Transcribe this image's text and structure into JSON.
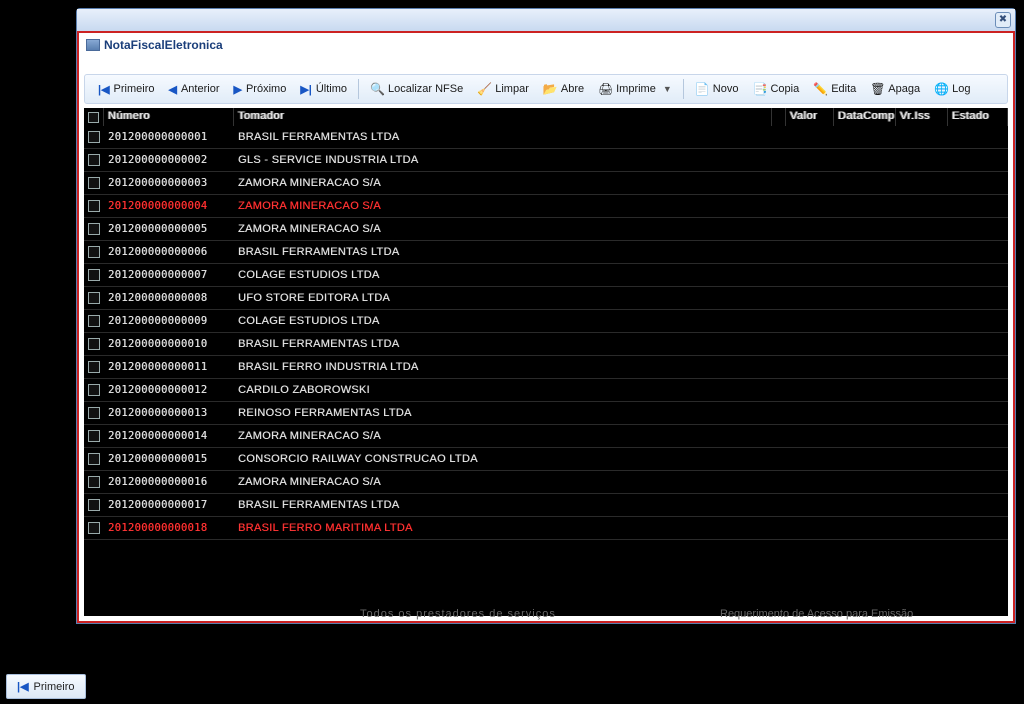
{
  "window": {
    "inner_title": "NotaFiscalEletronica"
  },
  "toolbar": {
    "primeiro": "Primeiro",
    "anterior": "Anterior",
    "proximo": "Próximo",
    "ultimo": "Último",
    "localizar": "Localizar NFSe",
    "limpar": "Limpar",
    "abre": "Abre",
    "imprime": "Imprime",
    "novo": "Novo",
    "copia": "Copia",
    "edita": "Edita",
    "apaga": "Apaga",
    "log": "Log"
  },
  "columns": {
    "numero": "Número",
    "tomador": "Tomador",
    "valor": "Valor",
    "dataComp": "DataComp",
    "vrIss": "Vr.Iss",
    "estado": "Estado"
  },
  "rows": [
    {
      "numero": "201200000000001",
      "tomador": "BRASIL FERRAMENTAS LTDA",
      "red": false
    },
    {
      "numero": "201200000000002",
      "tomador": "GLS - SERVICE INDUSTRIA LTDA",
      "red": false
    },
    {
      "numero": "201200000000003",
      "tomador": "ZAMORA MINERACAO S/A",
      "red": false
    },
    {
      "numero": "201200000000004",
      "tomador": "ZAMORA MINERACAO S/A",
      "red": true
    },
    {
      "numero": "201200000000005",
      "tomador": "ZAMORA MINERACAO S/A",
      "red": false
    },
    {
      "numero": "201200000000006",
      "tomador": "BRASIL FERRAMENTAS LTDA",
      "red": false
    },
    {
      "numero": "201200000000007",
      "tomador": "COLAGE ESTUDIOS LTDA",
      "red": false
    },
    {
      "numero": "201200000000008",
      "tomador": "UFO STORE EDITORA LTDA",
      "red": false
    },
    {
      "numero": "201200000000009",
      "tomador": "COLAGE ESTUDIOS LTDA",
      "red": false
    },
    {
      "numero": "201200000000010",
      "tomador": "BRASIL FERRAMENTAS LTDA",
      "red": false
    },
    {
      "numero": "201200000000011",
      "tomador": "BRASIL FERRO INDUSTRIA LTDA",
      "red": false
    },
    {
      "numero": "201200000000012",
      "tomador": "CARDILO ZABOROWSKI",
      "red": false
    },
    {
      "numero": "201200000000013",
      "tomador": "REINOSO FERRAMENTAS LTDA",
      "red": false
    },
    {
      "numero": "201200000000014",
      "tomador": "ZAMORA MINERACAO S/A",
      "red": false
    },
    {
      "numero": "201200000000015",
      "tomador": "CONSORCIO RAILWAY CONSTRUCAO LTDA",
      "red": false
    },
    {
      "numero": "201200000000016",
      "tomador": "ZAMORA MINERACAO S/A",
      "red": false
    },
    {
      "numero": "201200000000017",
      "tomador": "BRASIL FERRAMENTAS LTDA",
      "red": false
    },
    {
      "numero": "201200000000018",
      "tomador": "BRASIL FERRO MARITIMA LTDA",
      "red": true
    }
  ],
  "footer": {
    "textA": "Todos  os  prestadores  de  serviços",
    "textB": "Requerimento de Acesso para Emissão"
  },
  "standalone": {
    "primeiro": "Primeiro"
  }
}
